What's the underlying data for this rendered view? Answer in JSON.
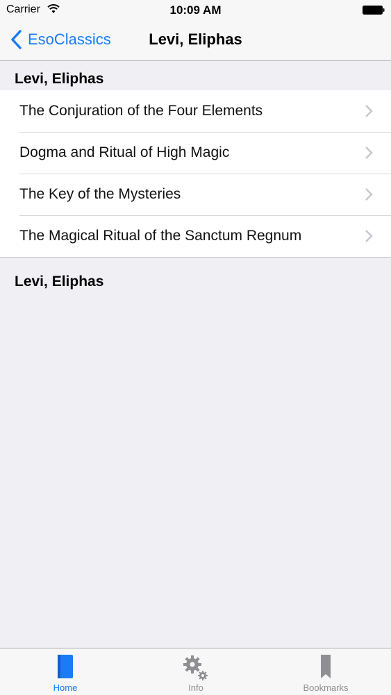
{
  "status_bar": {
    "carrier": "Carrier",
    "time": "10:09 AM"
  },
  "nav": {
    "back_label": "EsoClassics",
    "title": "Levi, Eliphas"
  },
  "sections": [
    {
      "header": "Levi, Eliphas",
      "items": [
        {
          "label": "The Conjuration of the Four Elements"
        },
        {
          "label": "Dogma and Ritual of High Magic"
        },
        {
          "label": "The Key of the Mysteries"
        },
        {
          "label": "The Magical Ritual of the Sanctum Regnum"
        }
      ]
    },
    {
      "header": "Levi, Eliphas",
      "items": []
    }
  ],
  "tabs": [
    {
      "label": "Home",
      "icon": "book-icon",
      "active": true
    },
    {
      "label": "Info",
      "icon": "gear-icon",
      "active": false
    },
    {
      "label": "Bookmarks",
      "icon": "bookmark-icon",
      "active": false
    }
  ],
  "colors": {
    "accent": "#1a7cf5",
    "background": "#efeff4",
    "inactive": "#8e8e93"
  }
}
